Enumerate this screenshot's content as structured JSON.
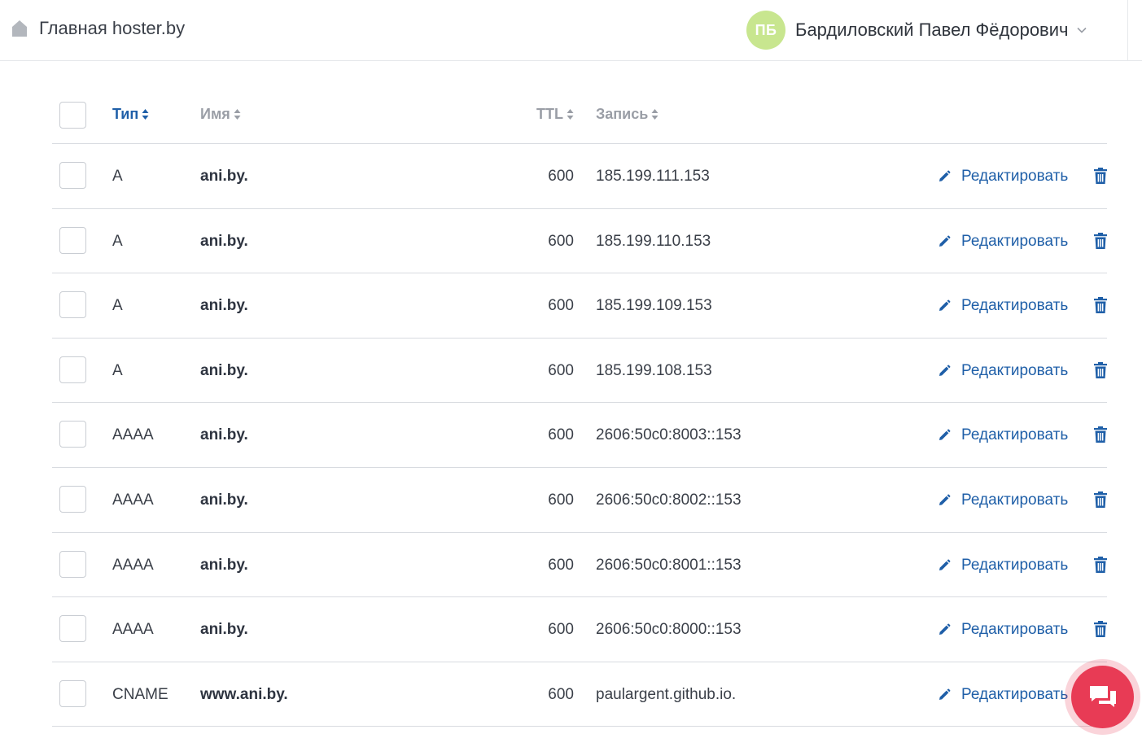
{
  "header": {
    "home_label": "Главная hoster.by",
    "home_icon": "home-icon",
    "user": {
      "initials": "ПБ",
      "name": "Бардиловский Павел Фёдорович",
      "avatar_color": "#c8e68f"
    }
  },
  "table": {
    "columns": {
      "type": "Тип",
      "name": "Имя",
      "ttl": "TTL",
      "record": "Запись"
    },
    "active_sort_column": "type",
    "edit_label": "Редактировать",
    "rows": [
      {
        "type": "A",
        "name": "ani.by.",
        "ttl": "600",
        "record": "185.199.111.153"
      },
      {
        "type": "A",
        "name": "ani.by.",
        "ttl": "600",
        "record": "185.199.110.153"
      },
      {
        "type": "A",
        "name": "ani.by.",
        "ttl": "600",
        "record": "185.199.109.153"
      },
      {
        "type": "A",
        "name": "ani.by.",
        "ttl": "600",
        "record": "185.199.108.153"
      },
      {
        "type": "AAAA",
        "name": "ani.by.",
        "ttl": "600",
        "record": "2606:50c0:8003::153"
      },
      {
        "type": "AAAA",
        "name": "ani.by.",
        "ttl": "600",
        "record": "2606:50c0:8002::153"
      },
      {
        "type": "AAAA",
        "name": "ani.by.",
        "ttl": "600",
        "record": "2606:50c0:8001::153"
      },
      {
        "type": "AAAA",
        "name": "ani.by.",
        "ttl": "600",
        "record": "2606:50c0:8000::153"
      },
      {
        "type": "CNAME",
        "name": "www.ani.by.",
        "ttl": "600",
        "record": "paulargent.github.io."
      }
    ]
  },
  "colors": {
    "link": "#1f5fa8",
    "chat_button": "#e83b55",
    "muted_header": "#9a9ea6"
  },
  "chat": {
    "icon": "chat-bubbles-icon"
  }
}
